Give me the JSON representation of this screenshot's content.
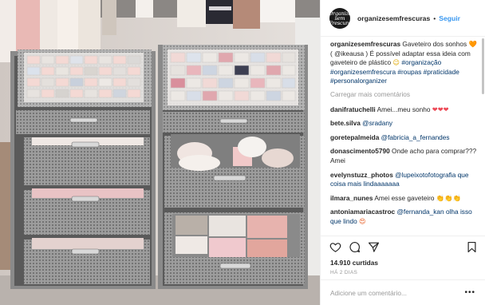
{
  "colors": {
    "link": "#3897f0",
    "hashtag": "#003569",
    "muted": "#999999",
    "heart": "#ed4956"
  },
  "header": {
    "avatar_text": "Organize sem Frescura",
    "username": "organizesemfrescuras",
    "separator": "•",
    "follow_label": "Seguir"
  },
  "caption": {
    "username": "organizesemfrescuras",
    "text_1": "Gaveteiro dos sonhos",
    "emoji_1": "🧡",
    "text_2": "( @ikeausa ) É possível adaptar essa ideia com gaveteiro de plástico",
    "emoji_2": "😉",
    "hashtags": "#organização #organizesemfrescura #roupas #praticidade #personalorganizer"
  },
  "load_more": "Carregar mais comentários",
  "comments": [
    {
      "user": "danifratuchelli",
      "text": "Amei...meu sonho",
      "emoji": "❤❤❤"
    },
    {
      "user": "bete.silva",
      "text": "@sradany",
      "emoji": ""
    },
    {
      "user": "goretepalmeida",
      "text": "@fabricia_a_fernandes",
      "emoji": ""
    },
    {
      "user": "donascimento5790",
      "text": "Onde acho para comprar??? Amei",
      "emoji": ""
    },
    {
      "user": "evelynstuzz_photos",
      "text": "@lupeixotofotografia que coisa mais lindaaaaaaa",
      "emoji": ""
    },
    {
      "user": "ilmara_nunes",
      "text": "Amei esse gaveteiro",
      "emoji": "👏👏👏"
    },
    {
      "user": "antoniamariacastroc",
      "text": "@fernanda_kan olha isso que lindo",
      "emoji": "😍"
    }
  ],
  "actions": {
    "like": "heart-icon",
    "comment": "comment-icon",
    "share": "share-icon",
    "save": "bookmark-icon"
  },
  "likes": {
    "count": "14.910",
    "label": "curtidas"
  },
  "timestamp": "HÁ 2 DIAS",
  "add_comment": {
    "placeholder": "Adicione um comentário...",
    "more": "•••"
  }
}
